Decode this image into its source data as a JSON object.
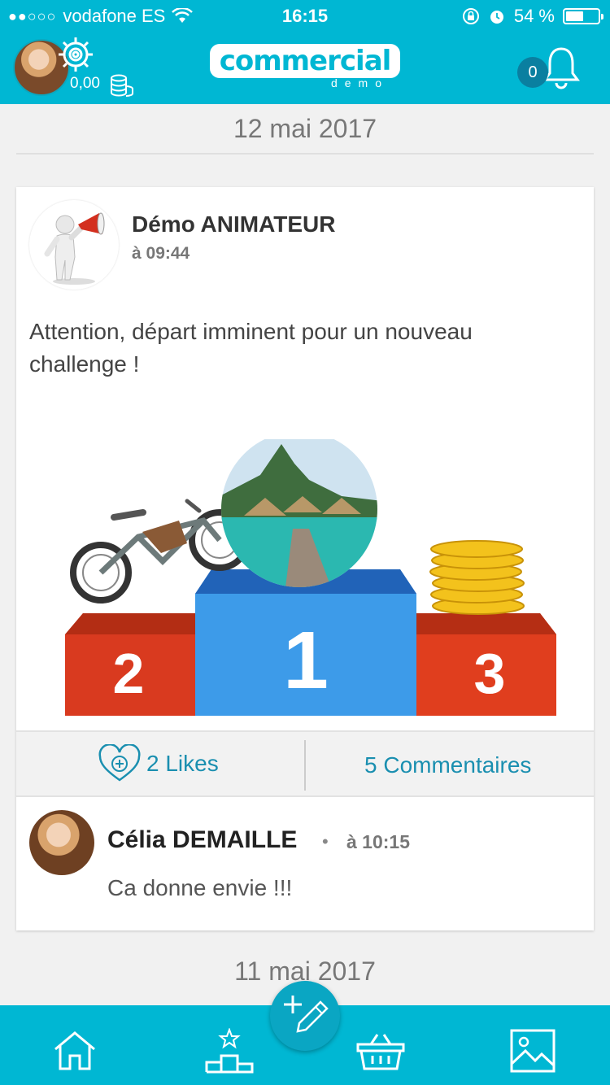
{
  "status_bar": {
    "signal": "●●○○○",
    "carrier": "vodafone ES",
    "time": "16:15",
    "battery_percent": "54 %",
    "battery_level": 0.54
  },
  "header": {
    "balance": "0,00",
    "logo_text": "commercial",
    "logo_subtext": "demo",
    "notification_count": "0"
  },
  "feed": {
    "date_1": "12 mai 2017",
    "date_2": "11 mai 2017",
    "post": {
      "author": "Démo ANIMATEUR",
      "time": "à 09:44",
      "text": "Attention, départ imminent pour un nouveau challenge !",
      "podium_labels": [
        "2",
        "1",
        "3"
      ],
      "likes_label": "2 Likes",
      "comments_label": "5 Commentaires"
    },
    "comment": {
      "author": "Célia DEMAILLE",
      "separator": "•",
      "time": "à 10:15",
      "text": "Ca donne envie !!!"
    }
  },
  "colors": {
    "brand": "#00b7d3",
    "link": "#1a8fb0",
    "podium_red": "#d93a1f",
    "podium_blue": "#3d9be9"
  },
  "icons": {
    "settings": "gear-icon",
    "coins": "coins-icon",
    "notifications": "bell-icon",
    "like": "heart-plus-icon",
    "compose": "pencil-plus-icon",
    "tabs": [
      "home-icon",
      "podium-star-icon",
      "basket-icon",
      "image-icon"
    ]
  }
}
